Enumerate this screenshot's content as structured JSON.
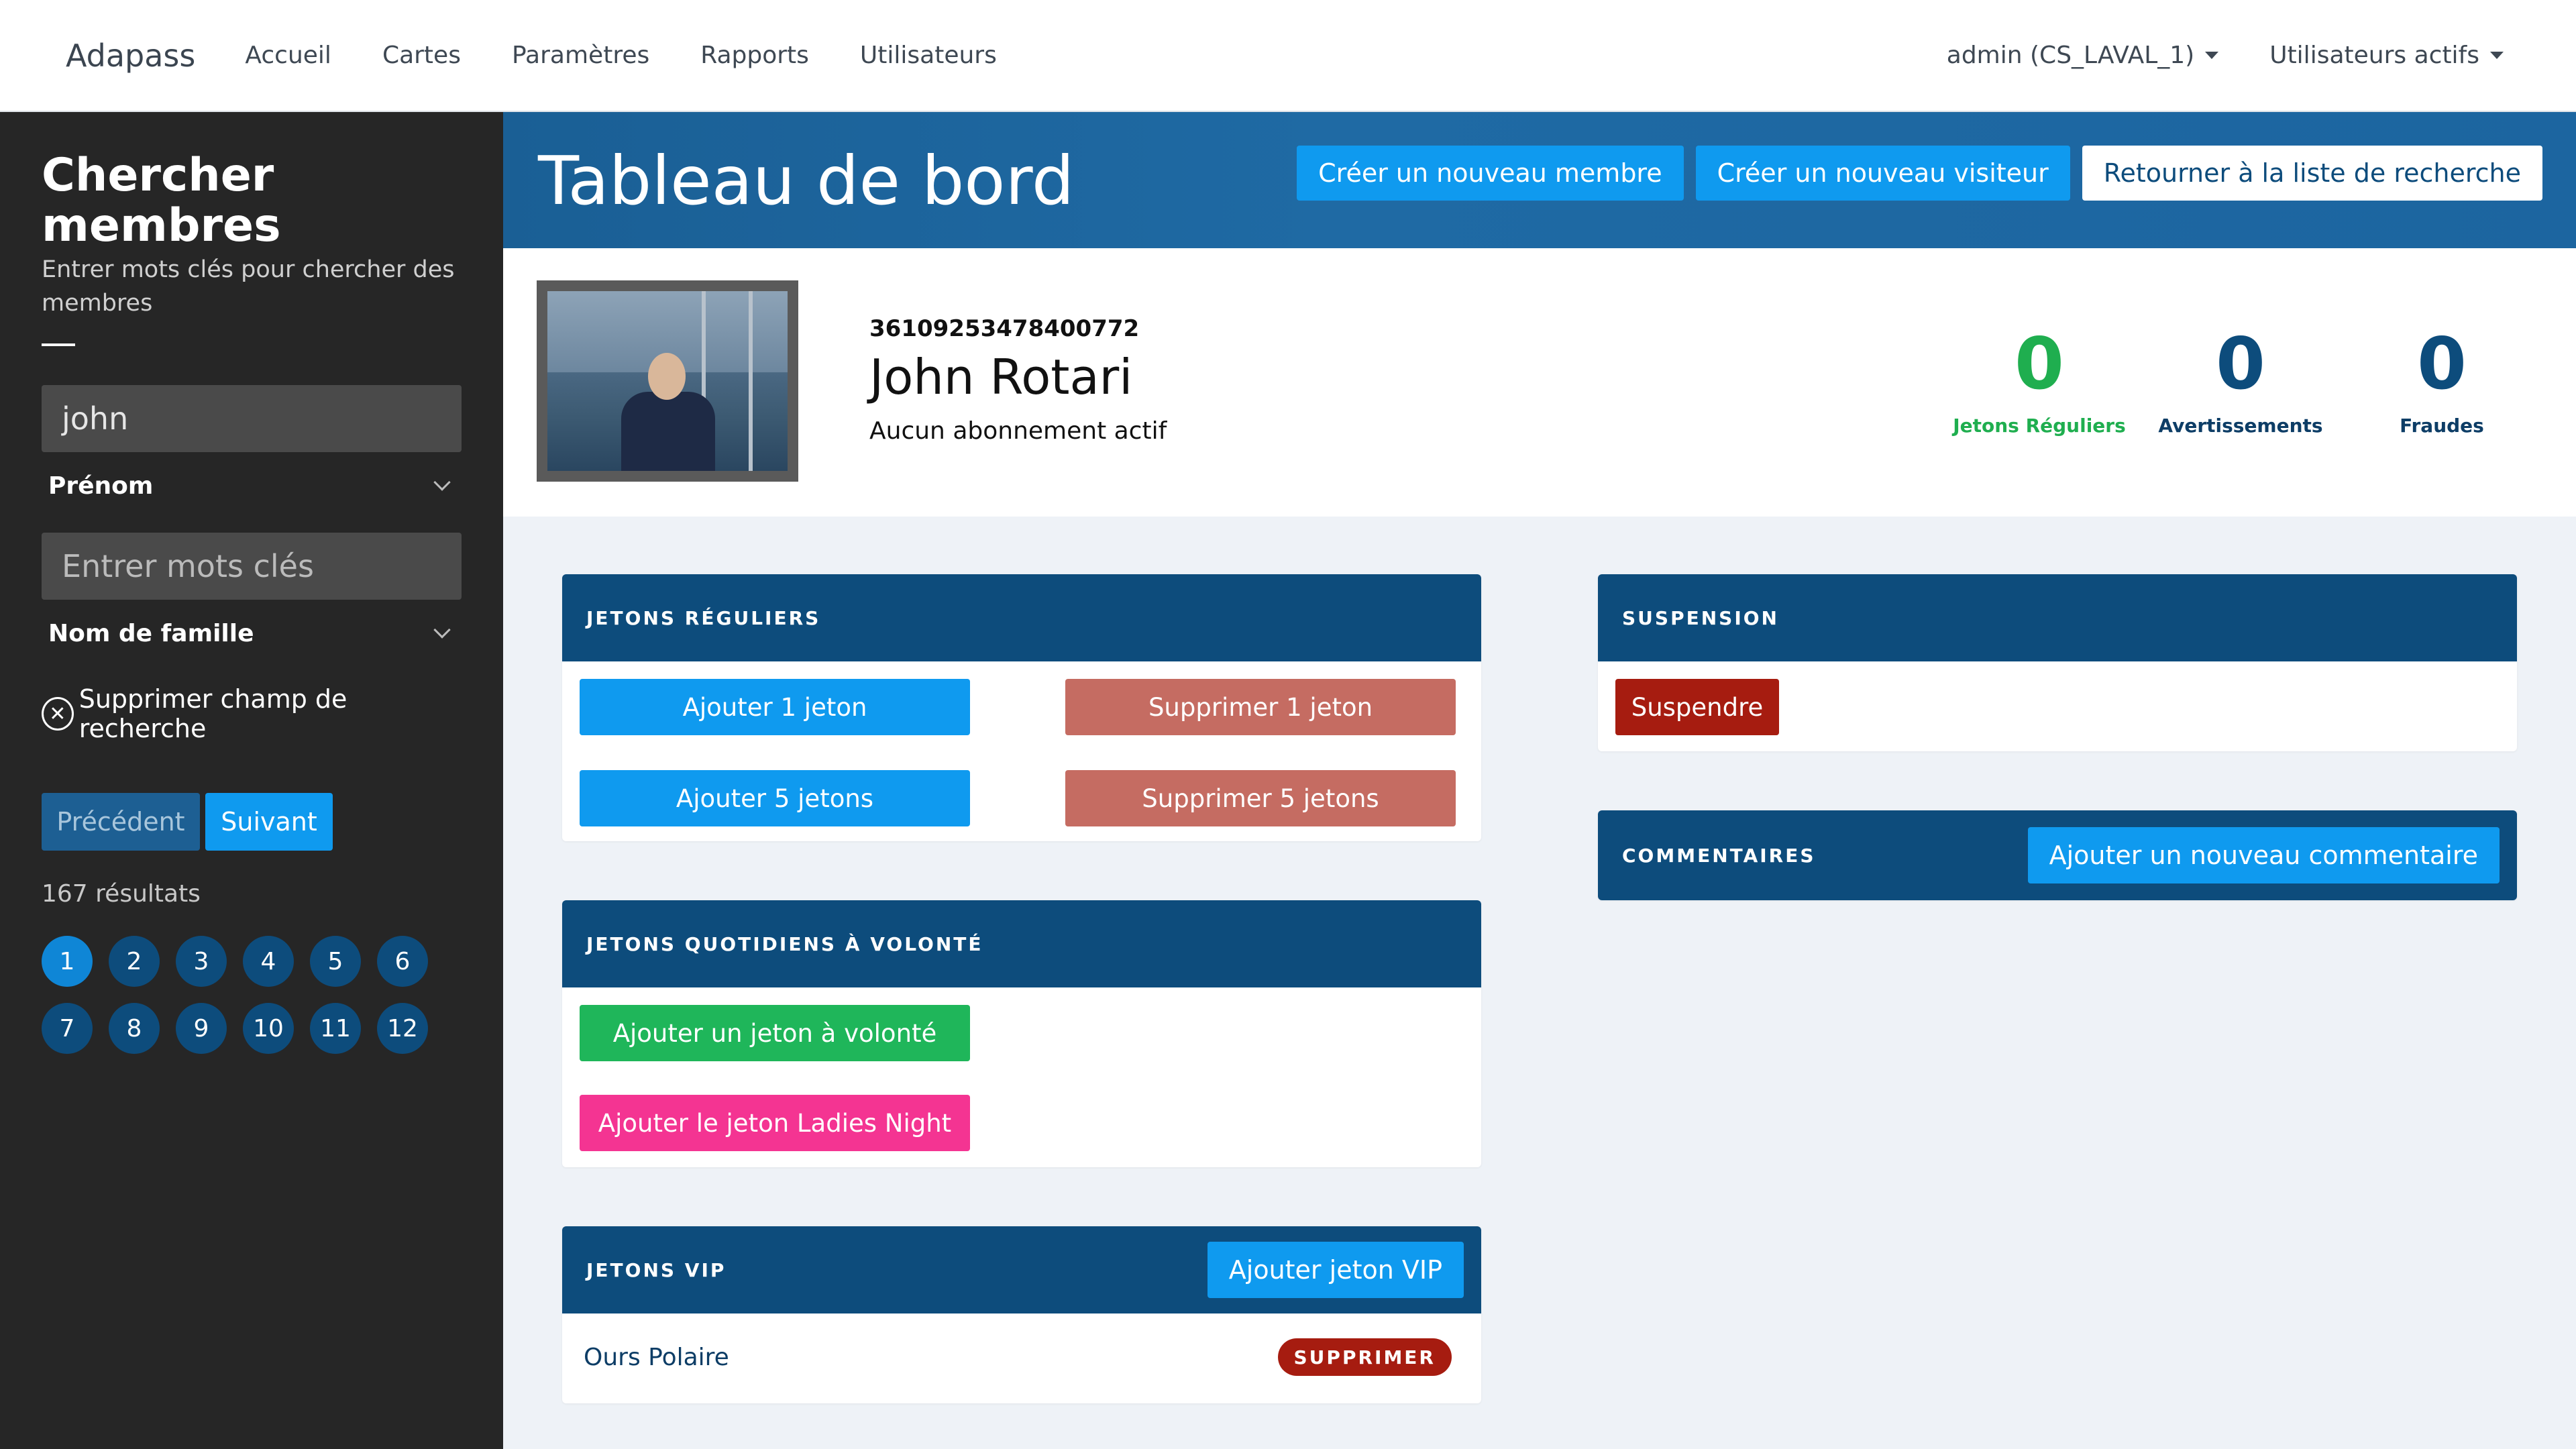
{
  "navbar": {
    "brand": "Adapass",
    "links": [
      "Accueil",
      "Cartes",
      "Paramètres",
      "Rapports",
      "Utilisateurs"
    ],
    "user_menu": "admin (CS_LAVAL_1)",
    "active_users_menu": "Utilisateurs actifs"
  },
  "sidebar": {
    "title": "Chercher membres",
    "subtitle": "Entrer mots clés pour chercher des membres",
    "search1": {
      "value": "john",
      "field": "Prénom"
    },
    "search2": {
      "placeholder": "Entrer mots clés",
      "field": "Nom de famille"
    },
    "clear_label": "Supprimer champ de recherche",
    "prev_label": "Précédent",
    "next_label": "Suivant",
    "results": "167 résultats",
    "pages": [
      "1",
      "2",
      "3",
      "4",
      "5",
      "6",
      "7",
      "8",
      "9",
      "10",
      "11",
      "12"
    ],
    "active_page": "1"
  },
  "header": {
    "title": "Tableau de bord",
    "btn_new_member": "Créer un nouveau membre",
    "btn_new_visitor": "Créer un nouveau visiteur",
    "btn_back": "Retourner à la liste de recherche"
  },
  "member": {
    "id": "36109253478400772",
    "name": "John Rotari",
    "status": "Aucun abonnement actif",
    "stats": [
      {
        "value": "0",
        "label": "Jetons Réguliers"
      },
      {
        "value": "0",
        "label": "Avertissements"
      },
      {
        "value": "0",
        "label": "Fraudes"
      }
    ]
  },
  "cards": {
    "regular": {
      "title": "JETONS RÉGULIERS",
      "add1": "Ajouter 1 jeton",
      "del1": "Supprimer 1 jeton",
      "add5": "Ajouter 5 jetons",
      "del5": "Supprimer 5 jetons"
    },
    "daily": {
      "title": "JETONS QUOTIDIENS À VOLONTÉ",
      "add_unlimited": "Ajouter un jeton à volonté",
      "add_ladies": "Ajouter le jeton Ladies Night"
    },
    "vip": {
      "title": "JETONS VIP",
      "add_vip": "Ajouter jeton VIP",
      "items": [
        {
          "name": "Ours Polaire",
          "action": "SUPPRIMER"
        }
      ]
    },
    "suspension": {
      "title": "SUSPENSION",
      "suspend": "Suspendre"
    },
    "comments": {
      "title": "COMMENTAIRES",
      "add_comment": "Ajouter un nouveau commentaire"
    }
  },
  "colors": {
    "primary_dark": "#0d4c7c",
    "accent_blue": "#0f9aef",
    "success": "#1fae4f",
    "danger": "#a61c10",
    "salmon": "#c56c62",
    "pink": "#f43492",
    "sidebar_bg": "#262626"
  }
}
